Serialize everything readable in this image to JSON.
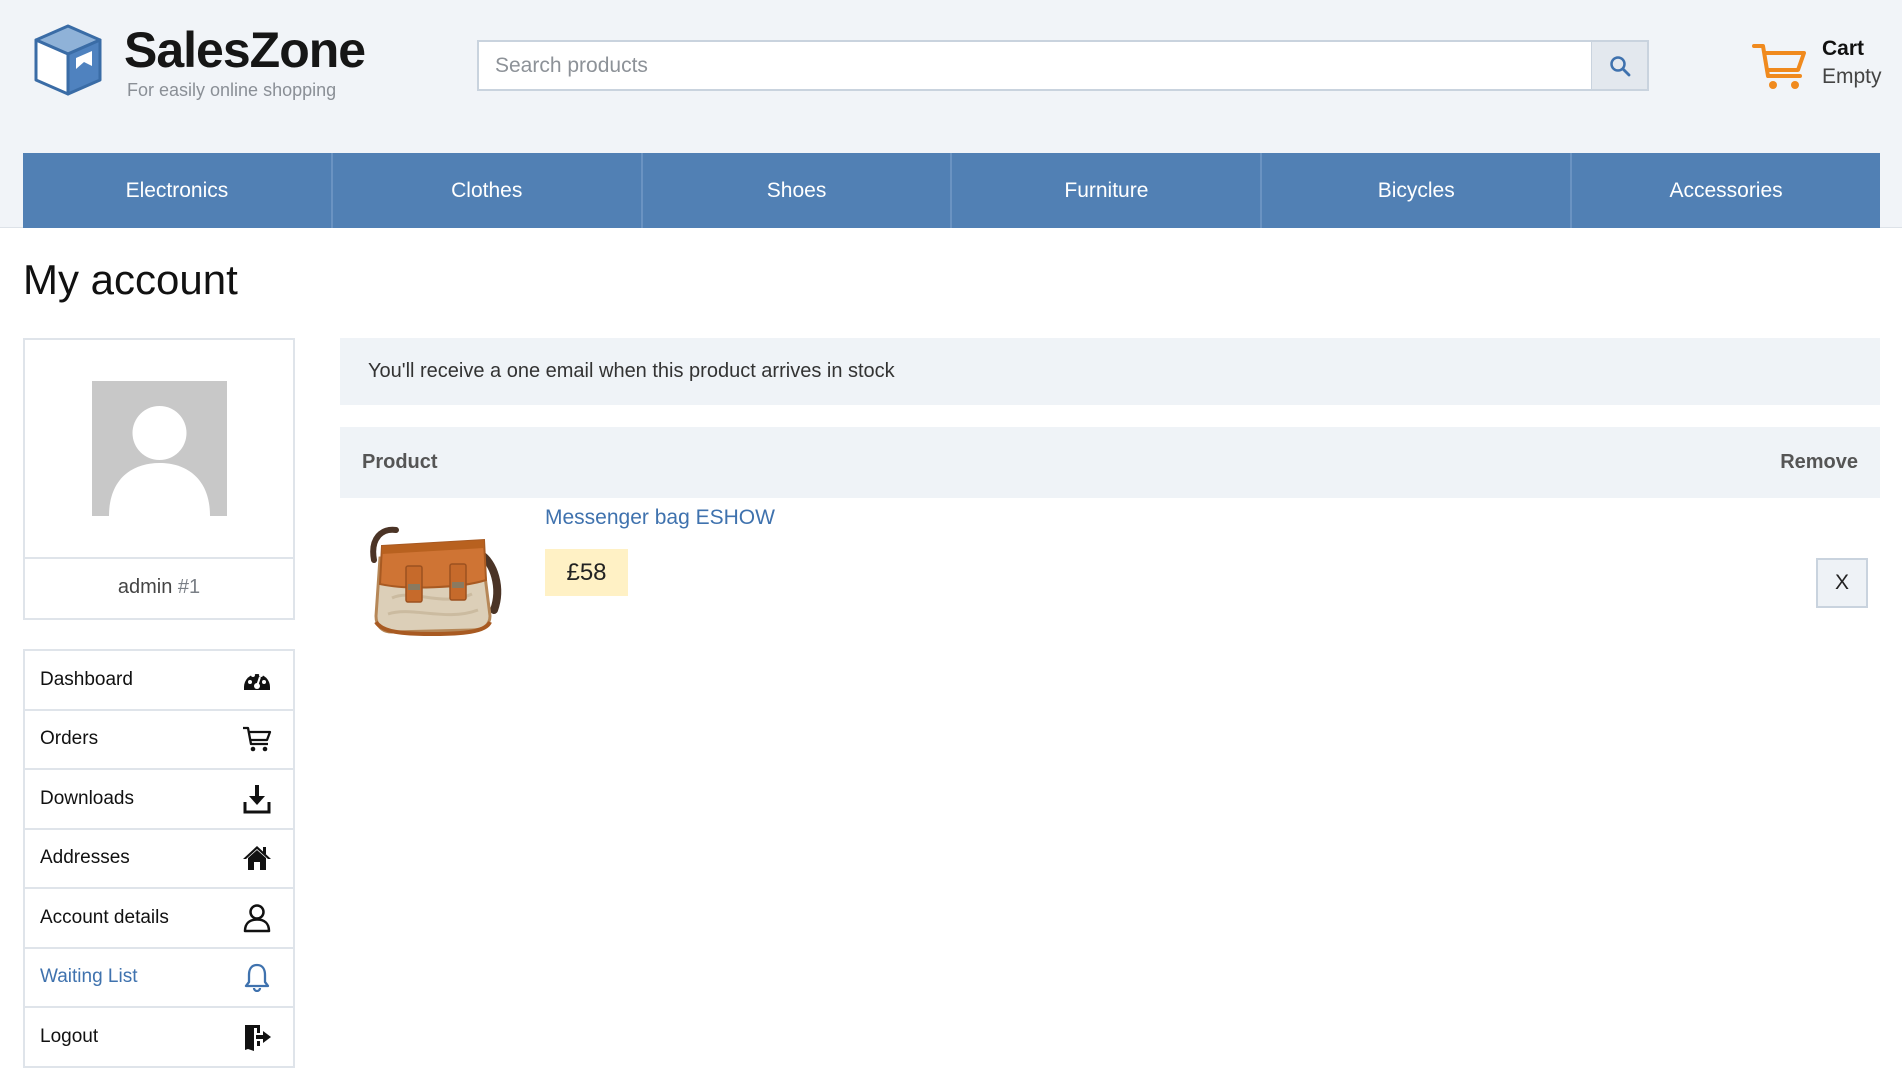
{
  "brand": {
    "name": "SalesZone",
    "tagline": "For easily online shopping"
  },
  "search": {
    "placeholder": "Search products",
    "value": ""
  },
  "cart": {
    "title": "Cart",
    "status": "Empty"
  },
  "nav": {
    "items": [
      {
        "label": "Electronics"
      },
      {
        "label": "Clothes"
      },
      {
        "label": "Shoes"
      },
      {
        "label": "Furniture"
      },
      {
        "label": "Bicycles"
      },
      {
        "label": "Accessories"
      }
    ]
  },
  "page": {
    "title": "My account"
  },
  "profile": {
    "username": "admin",
    "user_id": "#1"
  },
  "account_menu": {
    "items": [
      {
        "label": "Dashboard",
        "icon": "dashboard-gauge-icon"
      },
      {
        "label": "Orders",
        "icon": "cart-icon"
      },
      {
        "label": "Downloads",
        "icon": "download-icon"
      },
      {
        "label": "Addresses",
        "icon": "home-icon"
      },
      {
        "label": "Account details",
        "icon": "user-icon"
      },
      {
        "label": "Waiting List",
        "icon": "bell-icon",
        "active": true
      },
      {
        "label": "Logout",
        "icon": "logout-door-icon"
      }
    ]
  },
  "notice": {
    "text": "You'll receive a one email when this product arrives in stock"
  },
  "waiting_table": {
    "headers": {
      "product": "Product",
      "remove": "Remove"
    },
    "rows": [
      {
        "product_name": "Messenger bag ESHOW",
        "price": "£58",
        "remove_label": "X",
        "image": "messenger-bag-image"
      }
    ]
  },
  "colors": {
    "nav_background": "#5180b4",
    "link": "#3f72ae",
    "cart_accent": "#f08a1e",
    "price_badge": "#fff1c5",
    "header_background": "#f1f4f8"
  }
}
